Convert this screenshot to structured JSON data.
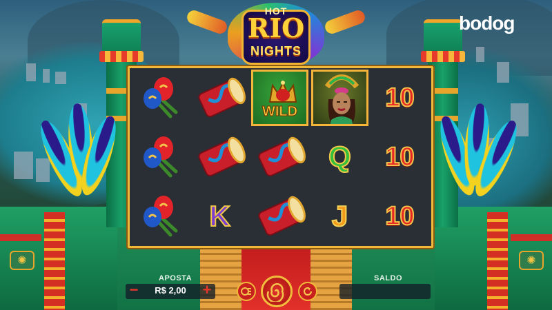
{
  "game": {
    "logo_hot": "HOT",
    "logo_rio": "RIO",
    "logo_nights": "NIGHTS"
  },
  "brand": {
    "name": "bodog"
  },
  "reels": [
    [
      "maracas",
      "maracas",
      "maracas"
    ],
    [
      "drum",
      "drum",
      "K"
    ],
    [
      "WILD",
      "drum",
      "drum"
    ],
    [
      "dancer",
      "Q",
      "J"
    ],
    [
      "10",
      "10",
      "10"
    ]
  ],
  "symbols": {
    "wild_label": "WILD",
    "ten": "10",
    "q": "Q",
    "k": "K",
    "j": "J"
  },
  "controls": {
    "bet_label": "APOSTA",
    "bet_value": "R$ 2,00",
    "minus": "−",
    "plus": "+",
    "balance_label": "SALDO",
    "balance_value": ""
  },
  "colors": {
    "frame": "#f0b93a",
    "reel_bg": "#2a2e35",
    "accent_red": "#e52823",
    "temple_green": "#1f8e58"
  },
  "icons": {
    "autoplay": "autoplay-icon",
    "spin": "spin-icon",
    "turbo": "turbo-icon"
  }
}
